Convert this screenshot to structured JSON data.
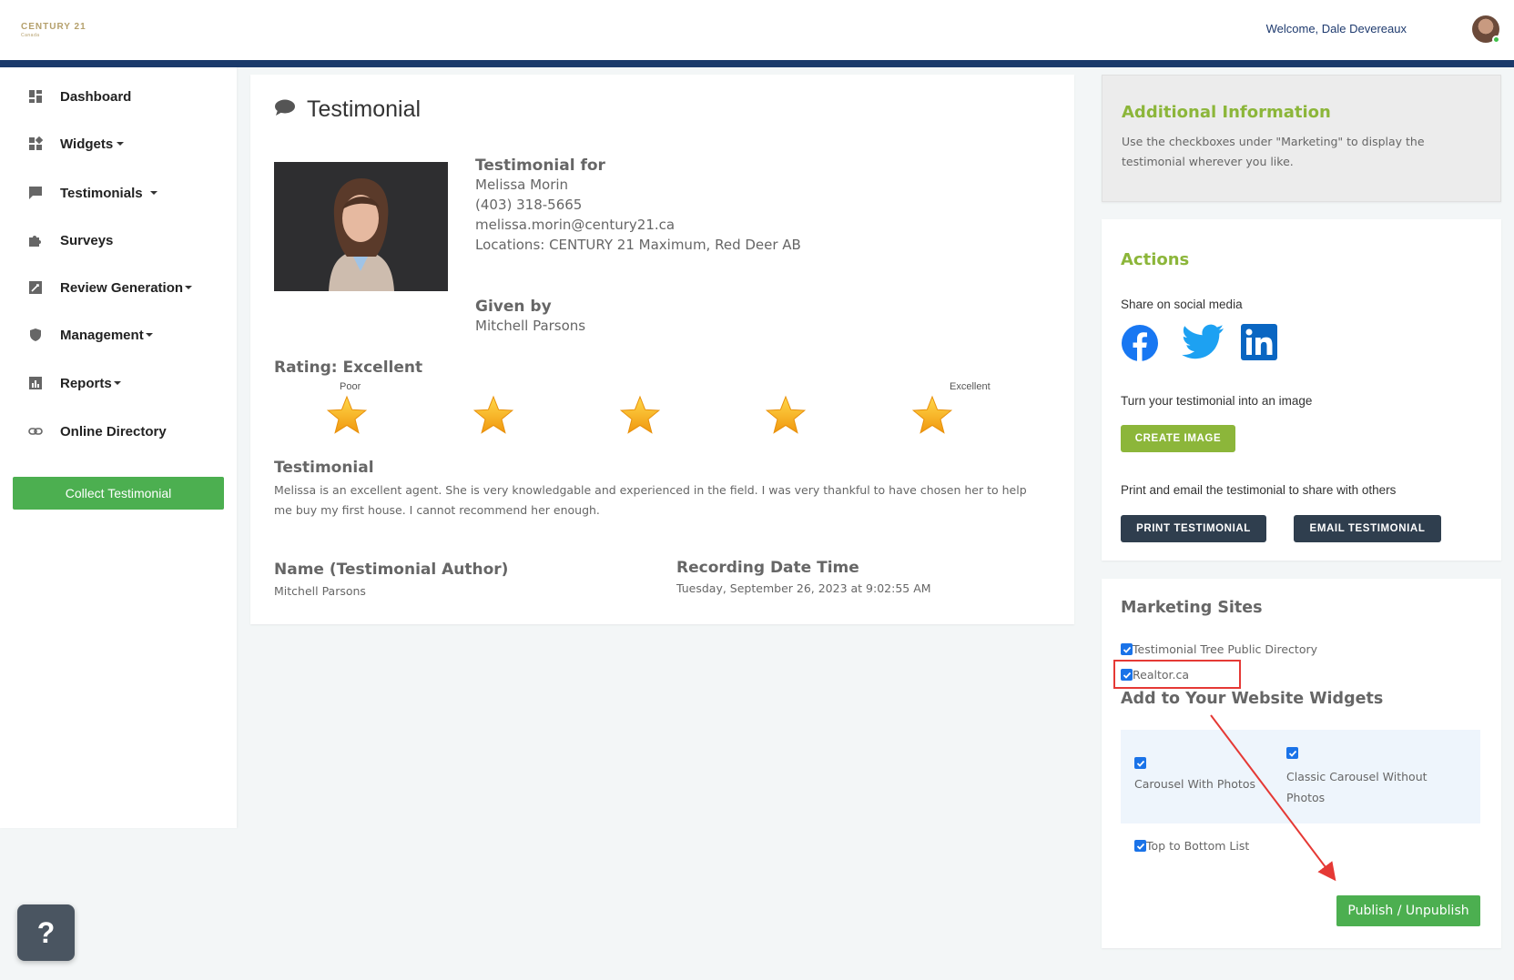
{
  "header": {
    "logo_text": "CENTURY 21",
    "logo_sub": "Canada",
    "welcome": "Welcome, Dale Devereaux"
  },
  "sidebar": {
    "items": [
      {
        "label": "Dashboard",
        "icon": "dashboard-icon"
      },
      {
        "label": "Widgets",
        "icon": "widgets-icon"
      },
      {
        "label": "Testimonials",
        "icon": "chat-icon"
      },
      {
        "label": "Surveys",
        "icon": "puzzle-icon"
      },
      {
        "label": "Review Generation",
        "icon": "edit-square-icon"
      },
      {
        "label": "Management",
        "icon": "shield-icon"
      },
      {
        "label": "Reports",
        "icon": "bar-chart-icon"
      },
      {
        "label": "Online Directory",
        "icon": "link-icon"
      }
    ],
    "collect_button": "Collect Testimonial"
  },
  "main": {
    "title": "Testimonial",
    "testimonial_for_heading": "Testimonial for",
    "agent_name": "Melissa Morin",
    "agent_phone": "(403) 318-5665",
    "agent_email": "melissa.morin@century21.ca",
    "agent_location": "Locations: CENTURY 21 Maximum, Red Deer AB",
    "given_by_heading": "Given by",
    "given_by_name": "Mitchell Parsons",
    "rating_title": "Rating: Excellent",
    "rating_low_label": "Poor",
    "rating_high_label": "Excellent",
    "rating_value": 5,
    "rating_max": 5,
    "testimonial_heading": "Testimonial",
    "testimonial_text": "Melissa is an excellent agent. She is very knowledgable and experienced in the field. I was very thankful to have chosen her to help me buy my first house. I cannot recommend her enough.",
    "author_heading": "Name (Testimonial Author)",
    "author_name": "Mitchell Parsons",
    "date_heading": "Recording Date Time",
    "date_value": "Tuesday, September 26, 2023 at 9:02:55 AM"
  },
  "additional": {
    "heading": "Additional Information",
    "text": "Use the checkboxes under \"Marketing\" to display the testimonial wherever you like."
  },
  "actions": {
    "heading": "Actions",
    "share_label": "Share on social media",
    "image_label": "Turn your testimonial into an image",
    "create_image": "CREATE IMAGE",
    "print_label": "Print and email the testimonial to share with others",
    "print_button": "PRINT TESTIMONIAL",
    "email_button": "EMAIL TESTIMONIAL"
  },
  "marketing": {
    "heading": "Marketing Sites",
    "sites": [
      {
        "label": "Testimonial Tree Public Directory",
        "checked": true
      },
      {
        "label": "Realtor.ca",
        "checked": true
      }
    ],
    "widgets_heading": "Add to Your Website Widgets",
    "widgets": [
      {
        "label": "Carousel With Photos",
        "checked": true
      },
      {
        "label": "Classic Carousel Without Photos",
        "checked": true
      },
      {
        "label": "Top to Bottom List",
        "checked": true
      }
    ],
    "publish_button": "Publish / Unpublish"
  },
  "colors": {
    "brand_navy": "#1b3a6b",
    "accent_green": "#8cb63a",
    "button_green": "#4caf50",
    "dark_button": "#2f3e4e",
    "annotation_red": "#e53935"
  },
  "help_label": "?"
}
